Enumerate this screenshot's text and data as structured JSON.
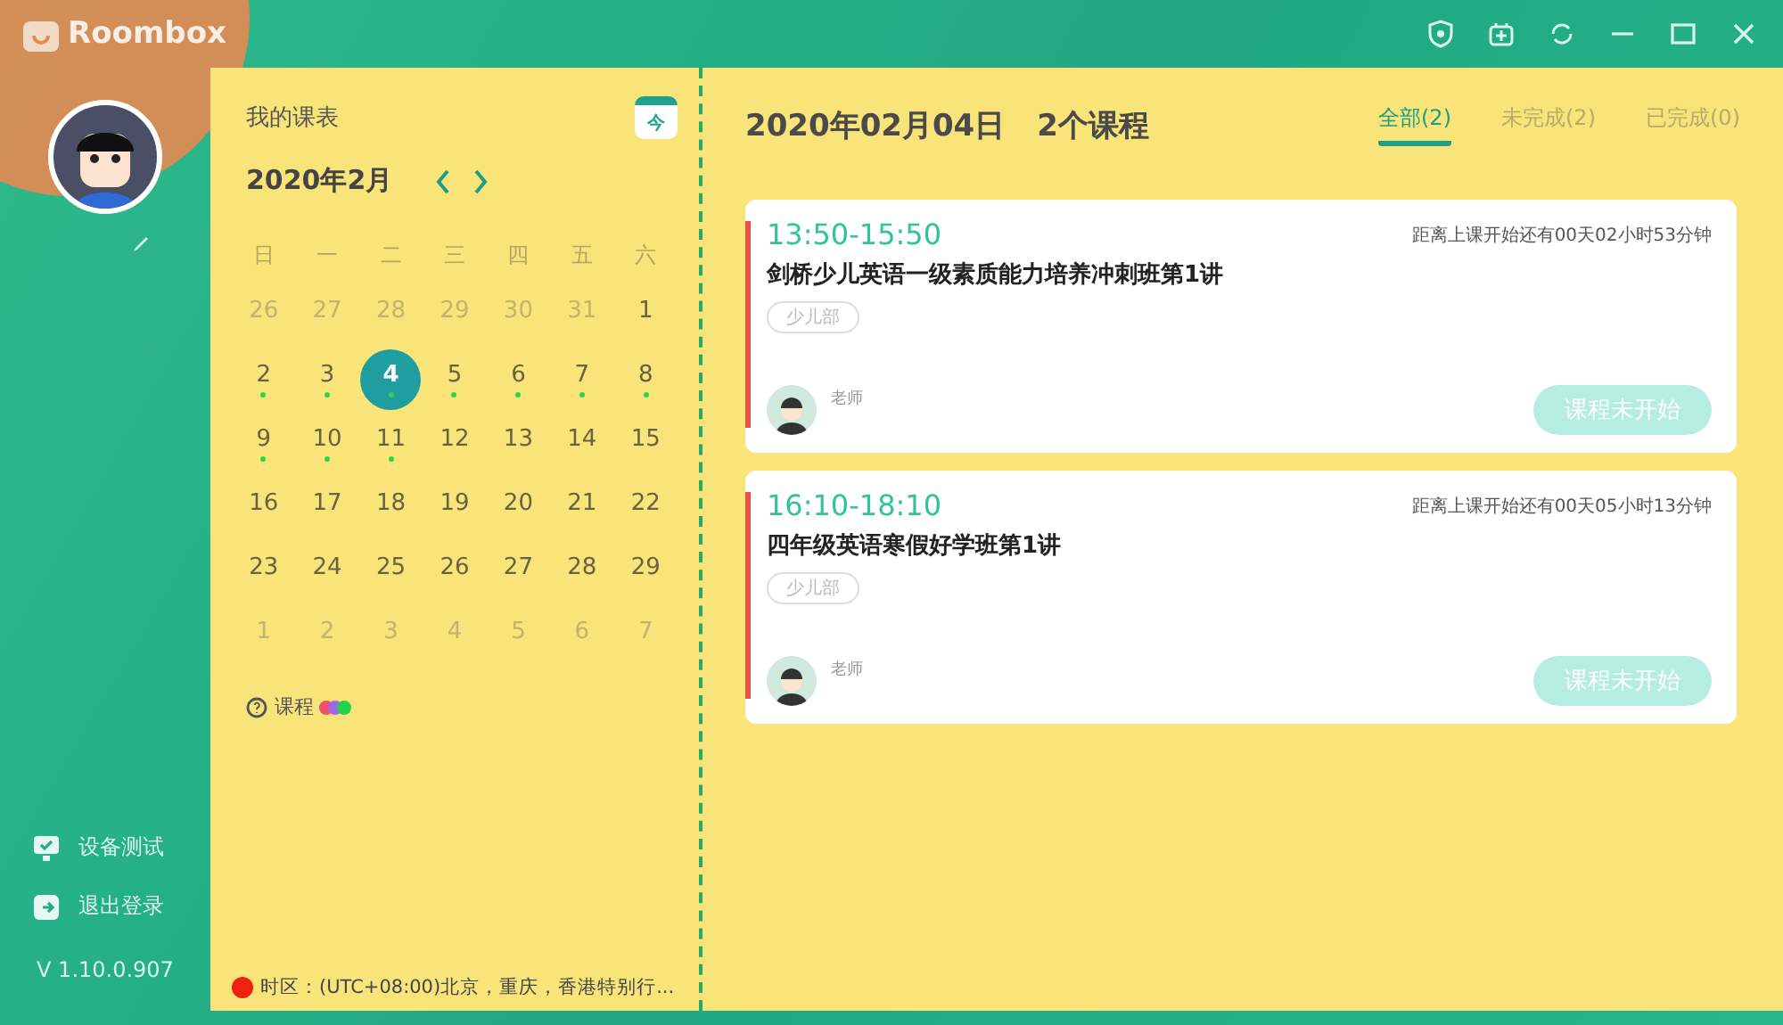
{
  "app": {
    "name": "Roombox"
  },
  "sidebar": {
    "menu": [
      {
        "kind": "device",
        "label": "设备测试"
      },
      {
        "kind": "logout",
        "label": "退出登录"
      }
    ],
    "version": "V 1.10.0.907"
  },
  "calendar": {
    "title": "我的课表",
    "today_label": "今",
    "month": "2020年2月",
    "weekdays": [
      "日",
      "一",
      "二",
      "三",
      "四",
      "五",
      "六"
    ],
    "weeks": [
      [
        {
          "day": "26",
          "muted": true,
          "selected": false,
          "has_class": false
        },
        {
          "day": "27",
          "muted": true,
          "selected": false,
          "has_class": false
        },
        {
          "day": "28",
          "muted": true,
          "selected": false,
          "has_class": false
        },
        {
          "day": "29",
          "muted": true,
          "selected": false,
          "has_class": false
        },
        {
          "day": "30",
          "muted": true,
          "selected": false,
          "has_class": false
        },
        {
          "day": "31",
          "muted": true,
          "selected": false,
          "has_class": false
        },
        {
          "day": "1",
          "muted": false,
          "selected": false,
          "has_class": false
        }
      ],
      [
        {
          "day": "2",
          "muted": false,
          "selected": false,
          "has_class": true
        },
        {
          "day": "3",
          "muted": false,
          "selected": false,
          "has_class": true
        },
        {
          "day": "4",
          "muted": false,
          "selected": true,
          "has_class": true
        },
        {
          "day": "5",
          "muted": false,
          "selected": false,
          "has_class": true
        },
        {
          "day": "6",
          "muted": false,
          "selected": false,
          "has_class": true
        },
        {
          "day": "7",
          "muted": false,
          "selected": false,
          "has_class": true
        },
        {
          "day": "8",
          "muted": false,
          "selected": false,
          "has_class": true
        }
      ],
      [
        {
          "day": "9",
          "muted": false,
          "selected": false,
          "has_class": true
        },
        {
          "day": "10",
          "muted": false,
          "selected": false,
          "has_class": true
        },
        {
          "day": "11",
          "muted": false,
          "selected": false,
          "has_class": true
        },
        {
          "day": "12",
          "muted": false,
          "selected": false,
          "has_class": false
        },
        {
          "day": "13",
          "muted": false,
          "selected": false,
          "has_class": false
        },
        {
          "day": "14",
          "muted": false,
          "selected": false,
          "has_class": false
        },
        {
          "day": "15",
          "muted": false,
          "selected": false,
          "has_class": false
        }
      ],
      [
        {
          "day": "16",
          "muted": false,
          "selected": false,
          "has_class": false
        },
        {
          "day": "17",
          "muted": false,
          "selected": false,
          "has_class": false
        },
        {
          "day": "18",
          "muted": false,
          "selected": false,
          "has_class": false
        },
        {
          "day": "19",
          "muted": false,
          "selected": false,
          "has_class": false
        },
        {
          "day": "20",
          "muted": false,
          "selected": false,
          "has_class": false
        },
        {
          "day": "21",
          "muted": false,
          "selected": false,
          "has_class": false
        },
        {
          "day": "22",
          "muted": false,
          "selected": false,
          "has_class": false
        }
      ],
      [
        {
          "day": "23",
          "muted": false,
          "selected": false,
          "has_class": false
        },
        {
          "day": "24",
          "muted": false,
          "selected": false,
          "has_class": false
        },
        {
          "day": "25",
          "muted": false,
          "selected": false,
          "has_class": false
        },
        {
          "day": "26",
          "muted": false,
          "selected": false,
          "has_class": false
        },
        {
          "day": "27",
          "muted": false,
          "selected": false,
          "has_class": false
        },
        {
          "day": "28",
          "muted": false,
          "selected": false,
          "has_class": false
        },
        {
          "day": "29",
          "muted": false,
          "selected": false,
          "has_class": false
        }
      ],
      [
        {
          "day": "1",
          "muted": true,
          "selected": false,
          "has_class": false
        },
        {
          "day": "2",
          "muted": true,
          "selected": false,
          "has_class": false
        },
        {
          "day": "3",
          "muted": true,
          "selected": false,
          "has_class": false
        },
        {
          "day": "4",
          "muted": true,
          "selected": false,
          "has_class": false
        },
        {
          "day": "5",
          "muted": true,
          "selected": false,
          "has_class": false
        },
        {
          "day": "6",
          "muted": true,
          "selected": false,
          "has_class": false
        },
        {
          "day": "7",
          "muted": true,
          "selected": false,
          "has_class": false
        }
      ]
    ],
    "legend": {
      "label": "课程",
      "dots": [
        {
          "color": "#f0506e"
        },
        {
          "color": "#a066e8"
        },
        {
          "color": "#22d34a"
        }
      ]
    },
    "timezone": "时区：(UTC+08:00)北京，重庆，香港特别行..."
  },
  "schedule": {
    "date": "2020年02月04日",
    "count": "2个课程",
    "tabs": [
      {
        "label": "全部(2)",
        "selected": true
      },
      {
        "label": "未完成(2)",
        "selected": false
      },
      {
        "label": "已完成(0)",
        "selected": false
      }
    ],
    "courses": [
      {
        "time": "13:50-15:50",
        "countdown": "距离上课开始还有00天02小时53分钟",
        "title": "剑桥少儿英语一级素质能力培养冲刺班第1讲",
        "tag": "少儿部",
        "teacher_label": "老师",
        "button": "课程未开始",
        "disabled": true
      },
      {
        "time": "16:10-18:10",
        "countdown": "距离上课开始还有00天05小时13分钟",
        "title": "四年级英语寒假好学班第1讲",
        "tag": "少儿部",
        "teacher_label": "老师",
        "button": "课程未开始",
        "disabled": true
      }
    ]
  }
}
